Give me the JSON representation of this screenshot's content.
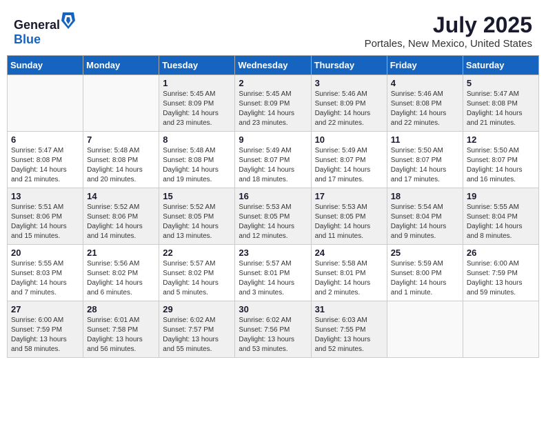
{
  "header": {
    "logo_general": "General",
    "logo_blue": "Blue",
    "month": "July 2025",
    "location": "Portales, New Mexico, United States"
  },
  "days_of_week": [
    "Sunday",
    "Monday",
    "Tuesday",
    "Wednesday",
    "Thursday",
    "Friday",
    "Saturday"
  ],
  "weeks": [
    [
      {
        "day": "",
        "info": ""
      },
      {
        "day": "",
        "info": ""
      },
      {
        "day": "1",
        "sunrise": "5:45 AM",
        "sunset": "8:09 PM",
        "daylight": "14 hours and 23 minutes."
      },
      {
        "day": "2",
        "sunrise": "5:45 AM",
        "sunset": "8:09 PM",
        "daylight": "14 hours and 23 minutes."
      },
      {
        "day": "3",
        "sunrise": "5:46 AM",
        "sunset": "8:09 PM",
        "daylight": "14 hours and 22 minutes."
      },
      {
        "day": "4",
        "sunrise": "5:46 AM",
        "sunset": "8:08 PM",
        "daylight": "14 hours and 22 minutes."
      },
      {
        "day": "5",
        "sunrise": "5:47 AM",
        "sunset": "8:08 PM",
        "daylight": "14 hours and 21 minutes."
      }
    ],
    [
      {
        "day": "6",
        "sunrise": "5:47 AM",
        "sunset": "8:08 PM",
        "daylight": "14 hours and 21 minutes."
      },
      {
        "day": "7",
        "sunrise": "5:48 AM",
        "sunset": "8:08 PM",
        "daylight": "14 hours and 20 minutes."
      },
      {
        "day": "8",
        "sunrise": "5:48 AM",
        "sunset": "8:08 PM",
        "daylight": "14 hours and 19 minutes."
      },
      {
        "day": "9",
        "sunrise": "5:49 AM",
        "sunset": "8:07 PM",
        "daylight": "14 hours and 18 minutes."
      },
      {
        "day": "10",
        "sunrise": "5:49 AM",
        "sunset": "8:07 PM",
        "daylight": "14 hours and 17 minutes."
      },
      {
        "day": "11",
        "sunrise": "5:50 AM",
        "sunset": "8:07 PM",
        "daylight": "14 hours and 17 minutes."
      },
      {
        "day": "12",
        "sunrise": "5:50 AM",
        "sunset": "8:07 PM",
        "daylight": "14 hours and 16 minutes."
      }
    ],
    [
      {
        "day": "13",
        "sunrise": "5:51 AM",
        "sunset": "8:06 PM",
        "daylight": "14 hours and 15 minutes."
      },
      {
        "day": "14",
        "sunrise": "5:52 AM",
        "sunset": "8:06 PM",
        "daylight": "14 hours and 14 minutes."
      },
      {
        "day": "15",
        "sunrise": "5:52 AM",
        "sunset": "8:05 PM",
        "daylight": "14 hours and 13 minutes."
      },
      {
        "day": "16",
        "sunrise": "5:53 AM",
        "sunset": "8:05 PM",
        "daylight": "14 hours and 12 minutes."
      },
      {
        "day": "17",
        "sunrise": "5:53 AM",
        "sunset": "8:05 PM",
        "daylight": "14 hours and 11 minutes."
      },
      {
        "day": "18",
        "sunrise": "5:54 AM",
        "sunset": "8:04 PM",
        "daylight": "14 hours and 9 minutes."
      },
      {
        "day": "19",
        "sunrise": "5:55 AM",
        "sunset": "8:04 PM",
        "daylight": "14 hours and 8 minutes."
      }
    ],
    [
      {
        "day": "20",
        "sunrise": "5:55 AM",
        "sunset": "8:03 PM",
        "daylight": "14 hours and 7 minutes."
      },
      {
        "day": "21",
        "sunrise": "5:56 AM",
        "sunset": "8:02 PM",
        "daylight": "14 hours and 6 minutes."
      },
      {
        "day": "22",
        "sunrise": "5:57 AM",
        "sunset": "8:02 PM",
        "daylight": "14 hours and 5 minutes."
      },
      {
        "day": "23",
        "sunrise": "5:57 AM",
        "sunset": "8:01 PM",
        "daylight": "14 hours and 3 minutes."
      },
      {
        "day": "24",
        "sunrise": "5:58 AM",
        "sunset": "8:01 PM",
        "daylight": "14 hours and 2 minutes."
      },
      {
        "day": "25",
        "sunrise": "5:59 AM",
        "sunset": "8:00 PM",
        "daylight": "14 hours and 1 minute."
      },
      {
        "day": "26",
        "sunrise": "6:00 AM",
        "sunset": "7:59 PM",
        "daylight": "13 hours and 59 minutes."
      }
    ],
    [
      {
        "day": "27",
        "sunrise": "6:00 AM",
        "sunset": "7:59 PM",
        "daylight": "13 hours and 58 minutes."
      },
      {
        "day": "28",
        "sunrise": "6:01 AM",
        "sunset": "7:58 PM",
        "daylight": "13 hours and 56 minutes."
      },
      {
        "day": "29",
        "sunrise": "6:02 AM",
        "sunset": "7:57 PM",
        "daylight": "13 hours and 55 minutes."
      },
      {
        "day": "30",
        "sunrise": "6:02 AM",
        "sunset": "7:56 PM",
        "daylight": "13 hours and 53 minutes."
      },
      {
        "day": "31",
        "sunrise": "6:03 AM",
        "sunset": "7:55 PM",
        "daylight": "13 hours and 52 minutes."
      },
      {
        "day": "",
        "info": ""
      },
      {
        "day": "",
        "info": ""
      }
    ]
  ]
}
